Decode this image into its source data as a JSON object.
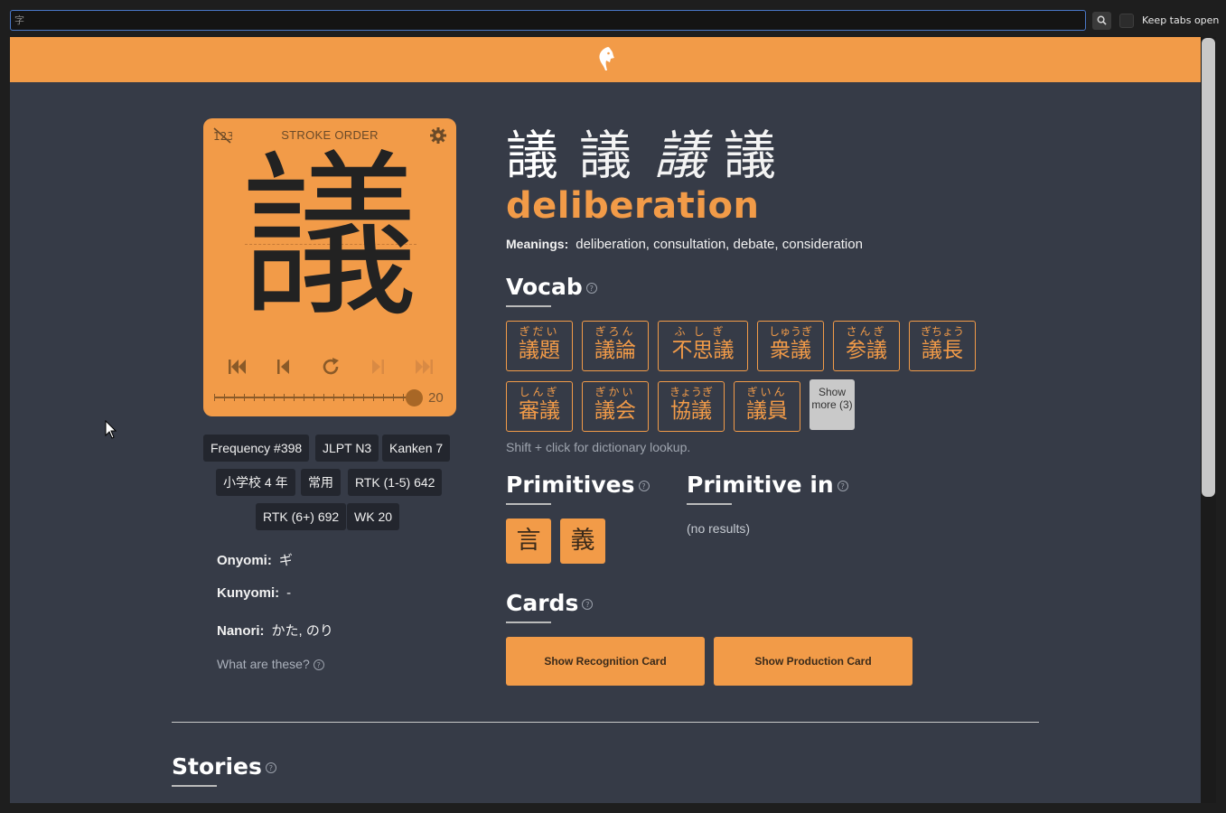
{
  "search": {
    "value": "字",
    "button_icon": "search-icon"
  },
  "keep_tabs": {
    "label": "Keep tabs open",
    "checked": false
  },
  "stroke_order": {
    "title": "STROKE ORDER",
    "kanji": "議",
    "step": "20"
  },
  "badges": {
    "frequency": "Frequency #398",
    "jlpt": "JLPT N3",
    "kanken": "Kanken 7",
    "grade": "小学校 4 年",
    "joyo": "常用",
    "rtk1": "RTK (1-5) 642",
    "rtk6": "RTK (6+) 692",
    "wk": "WK 20"
  },
  "readings": {
    "onyomi_label": "Onyomi:",
    "onyomi": "ギ",
    "kunyomi_label": "Kunyomi:",
    "kunyomi": "-",
    "nanori_label": "Nanori:",
    "nanori": "かた, のり",
    "what_are_these": "What are these?"
  },
  "header": {
    "kanji_variants": [
      "議",
      "議",
      "議",
      "議"
    ],
    "meaning": "deliberation",
    "meanings_label": "Meanings:",
    "meanings": "deliberation, consultation, debate, consideration"
  },
  "vocab": {
    "title": "Vocab",
    "items": [
      {
        "furigana": "ぎだい",
        "word": "議題"
      },
      {
        "furigana": "ぎろん",
        "word": "議論"
      },
      {
        "furigana": "ふしぎ",
        "word": "不思議"
      },
      {
        "furigana": "しゅうぎ",
        "word": "衆議"
      },
      {
        "furigana": "さんぎ",
        "word": "参議"
      },
      {
        "furigana": "ぎちょう",
        "word": "議長"
      },
      {
        "furigana": "しんぎ",
        "word": "審議"
      },
      {
        "furigana": "ぎかい",
        "word": "議会"
      },
      {
        "furigana": "きょうぎ",
        "word": "協議"
      },
      {
        "furigana": "ぎいん",
        "word": "議員"
      }
    ],
    "show_more": "Show more (3)",
    "hint": "Shift + click for dictionary lookup."
  },
  "primitives": {
    "title": "Primitives",
    "items": [
      "言",
      "義"
    ]
  },
  "primitive_in": {
    "title": "Primitive in",
    "empty": "(no results)"
  },
  "cards": {
    "title": "Cards",
    "recognition": "Show Recognition Card",
    "production": "Show Production Card"
  },
  "stories": {
    "title": "Stories"
  },
  "colors": {
    "accent": "#f29b48",
    "background": "#363b47",
    "badge": "#23262e"
  }
}
